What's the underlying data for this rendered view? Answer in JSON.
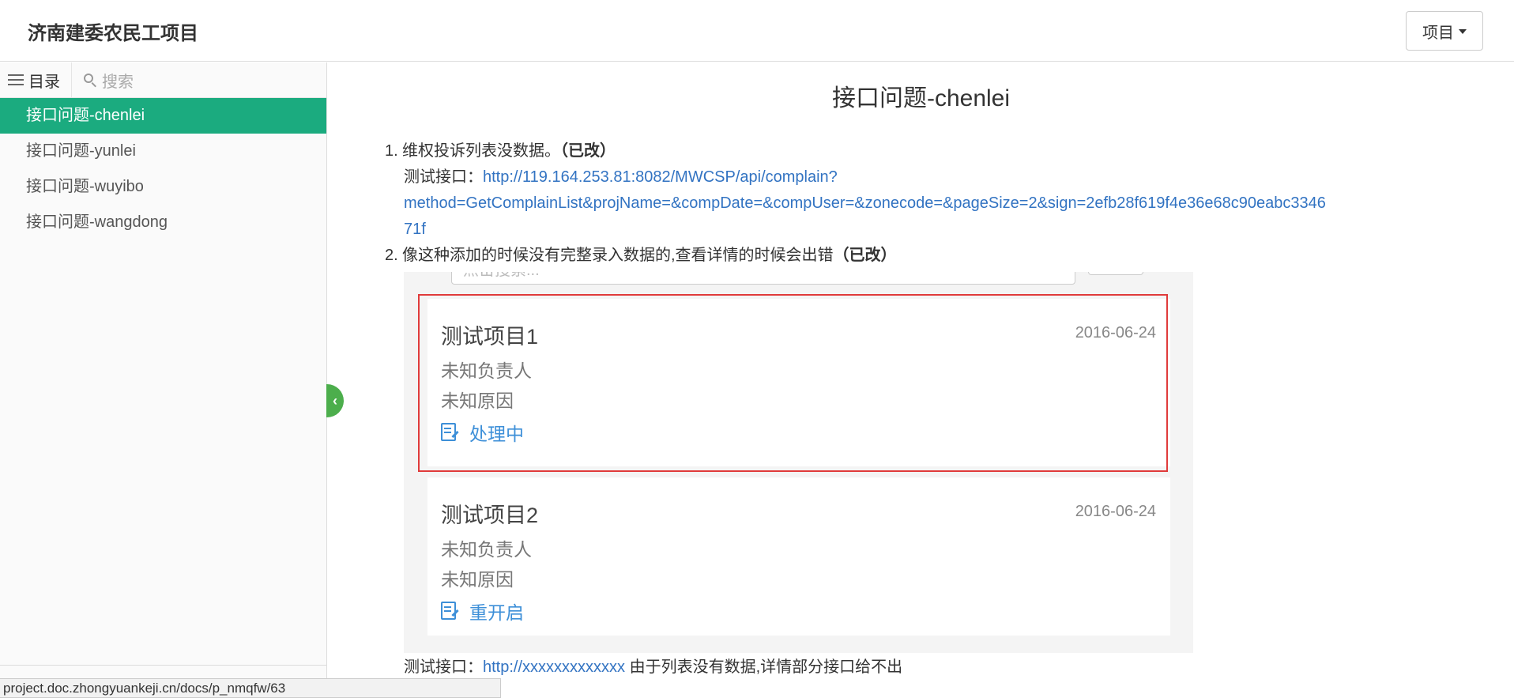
{
  "header": {
    "site_title": "济南建委农民工项目",
    "project_button": "项目"
  },
  "sidebar": {
    "toc_label": "目录",
    "search_placeholder": "搜索",
    "items": [
      {
        "label": "接口问题-chenlei",
        "active": true
      },
      {
        "label": "接口问题-yunlei",
        "active": false
      },
      {
        "label": "接口问题-wuyibo",
        "active": false
      },
      {
        "label": "接口问题-wangdong",
        "active": false
      }
    ]
  },
  "status_url": "project.doc.zhongyuankeji.cn/docs/p_nmqfw/63",
  "doc": {
    "title": "接口问题-chenlei",
    "item1": {
      "number": "1.",
      "text": "维权投诉列表没数据。",
      "status": "（已改）",
      "test_label": "测试接口：",
      "url": "http://119.164.253.81:8082/MWCSP/api/complain?method=GetComplainList&projName=&compDate=&compUser=&zonecode=&pageSize=2&sign=2efb28f619f4e36e68c90eabc334671f",
      "url_line1": "http://119.164.253.81:8082/MWCSP/api/complain?",
      "url_line2": "method=GetComplainList&projName=&compDate=&compUser=&zonecode=&pageSize=2&sign=2efb28f619f4e36e68c90eabc3346",
      "url_line3": "71f"
    },
    "item2": {
      "number": "2.",
      "text": "像这种添加的时候没有完整录入数据的,查看详情的时候会出错",
      "status": "（已改）"
    },
    "screenshot": {
      "search_placeholder": "点击搜索...",
      "cards": [
        {
          "title": "测试项目1",
          "date": "2016-06-24",
          "owner": "未知负责人",
          "reason": "未知原因",
          "status": "处理中"
        },
        {
          "title": "测试项目2",
          "date": "2016-06-24",
          "owner": "未知负责人",
          "reason": "未知原因",
          "status": "重开启"
        }
      ]
    },
    "footer_line": {
      "label": "测试接口：",
      "link": "http://xxxxxxxxxxxxx",
      "note": " 由于列表没有数据,详情部分接口给不出"
    }
  },
  "colors": {
    "active_green": "#1bab7f",
    "link_blue": "#3273c2",
    "highlight_red": "#e03b3b",
    "status_blue": "#3d8fd8",
    "handle_green": "#4cae4c"
  }
}
